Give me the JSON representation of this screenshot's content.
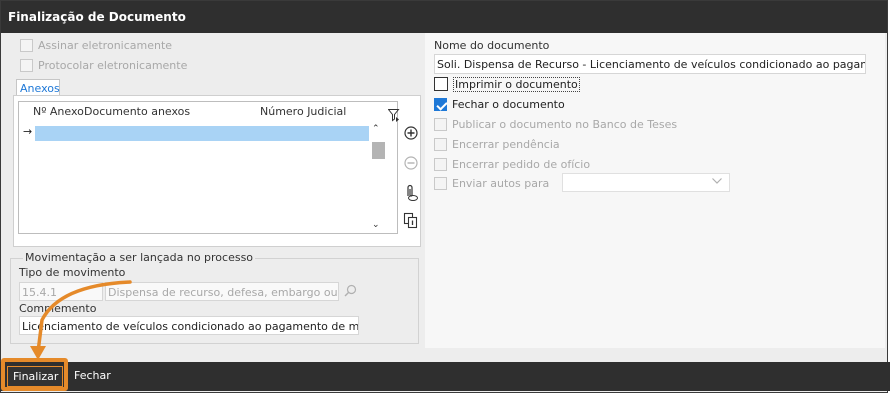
{
  "window": {
    "title": "Finalização de Documento"
  },
  "left": {
    "sign_label": "Assinar eletronicamente",
    "protocol_label": "Protocolar eletronicamente",
    "tab_label": "Anexos",
    "grid": {
      "col_num": "Nº Anexo",
      "col_doc": "Documento anexos",
      "col_judicial": "Número Judicial",
      "row_indicator": "→"
    }
  },
  "movement": {
    "group_title": "Movimentação a ser lançada no processo",
    "type_label": "Tipo de movimento",
    "type_code": "15.4.1",
    "type_desc": "Dispensa de recurso, defesa, embargo ou mar",
    "complement_label": "Complemento",
    "complement_value": "Licenciamento de veículos condicionado ao pagamento de multas"
  },
  "right": {
    "doc_name_label": "Nome do documento",
    "doc_name_value": "Soli. Dispensa de Recurso - Licenciamento de veículos condicionado ao pagamento d",
    "options": [
      {
        "label": "Imprimir o documento",
        "checked": false,
        "enabled": true
      },
      {
        "label": "Fechar o documento",
        "checked": true,
        "enabled": true
      },
      {
        "label": "Publicar o documento no Banco de Teses",
        "checked": false,
        "enabled": false
      },
      {
        "label": "Encerrar pendência",
        "checked": false,
        "enabled": false
      },
      {
        "label": "Encerrar pedido de ofício",
        "checked": false,
        "enabled": false
      },
      {
        "label": "Enviar autos para",
        "checked": false,
        "enabled": false
      }
    ],
    "send_to_value": ""
  },
  "footer": {
    "finalize_label": "Finalizar",
    "close_label": "Fechar"
  },
  "colors": {
    "titlebar": "#2f2f2f",
    "accent_blue": "#1e78d7",
    "highlight_orange": "#e58a2a",
    "selected_row": "#a9d3f5"
  },
  "icons": [
    "filter-icon",
    "add-icon",
    "remove-icon",
    "attach-icon",
    "copy-icon",
    "search-icon",
    "chevron-down-icon",
    "scroll-up-icon",
    "scroll-down-icon"
  ]
}
